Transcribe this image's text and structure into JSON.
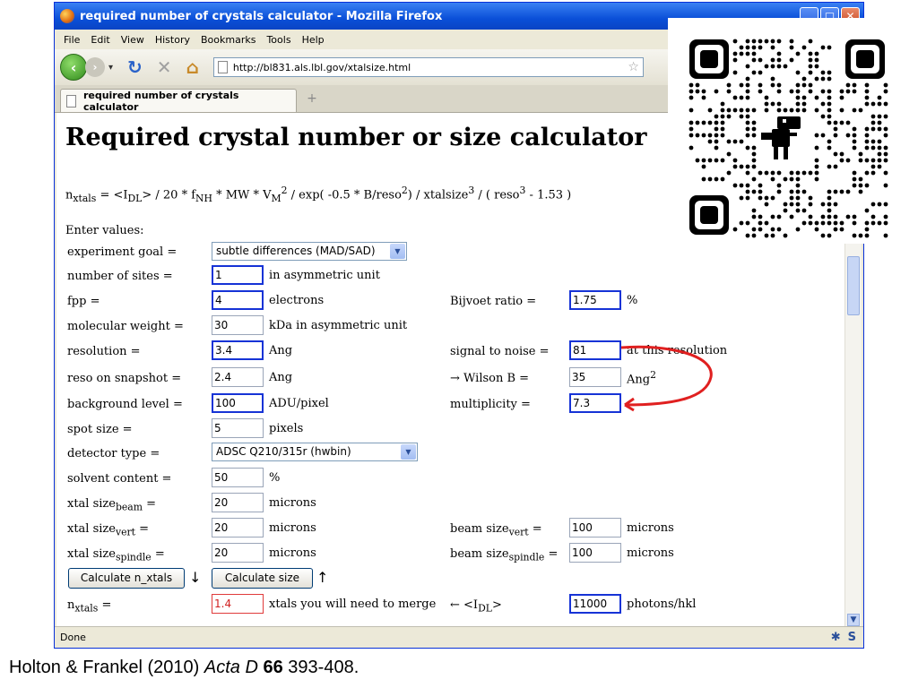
{
  "window": {
    "title": "required number of crystals calculator - Mozilla Firefox"
  },
  "menu": [
    "File",
    "Edit",
    "View",
    "History",
    "Bookmarks",
    "Tools",
    "Help"
  ],
  "nav": {
    "url": "http://bl831.als.lbl.gov/xtalsize.html"
  },
  "tab": {
    "label": "required number of crystals calculator",
    "new_tab_glyph": "+"
  },
  "page": {
    "heading": "Required crystal number or size calculator",
    "formula": "n_xtals = <I_DL> / 20 * f_NH * MW * V_M^2 / exp( -0.5 * B/reso^2) / xtalsize^3 / ( reso^3 - 1.53 )",
    "formula_parts": {
      "n": "n",
      "n_sub": "xtals",
      "eq1": " = <I",
      "idl_sub": "DL",
      "eq2": "> / 20 * f",
      "fnh_sub": "NH",
      "eq3": " * MW * V",
      "vm_sub": "M",
      "vm_sup": "2",
      "eq4": " / exp( -0.5 * B/reso",
      "reso_sup": "2",
      "eq5": ") / xtalsize",
      "xtal_sup": "3",
      "eq6": " / ( reso",
      "reso3_sup": "3",
      "eq7": " - 1.53 )"
    },
    "enter_values": "Enter values:",
    "rows": {
      "goal_label": "experiment goal =",
      "goal_value": "subtle differences (MAD/SAD)",
      "sites_label": "number of sites =",
      "sites_value": "1",
      "sites_unit": "in asymmetric unit",
      "fpp_label": "fpp =",
      "fpp_value": "4",
      "fpp_unit": "electrons",
      "mw_label": "molecular weight =",
      "mw_value": "30",
      "mw_unit": "kDa in asymmetric unit",
      "res_label": "resolution =",
      "res_value": "3.4",
      "res_unit": "Ang",
      "snap_label": "reso on snapshot =",
      "snap_value": "2.4",
      "snap_unit": "Ang",
      "bg_label": "background level =",
      "bg_value": "100",
      "bg_unit": "ADU/pixel",
      "spot_label": "spot size =",
      "spot_value": "5",
      "spot_unit": "pixels",
      "det_label": "detector type =",
      "det_value": "ADSC Q210/315r (hwbin)",
      "solv_label": "solvent content =",
      "solv_value": "50",
      "solv_unit": "%",
      "xbeam_label": "xtal size",
      "xbeam_sub": "beam",
      "xbeam_eq": " =",
      "xbeam_value": "20",
      "xbeam_unit": "microns",
      "xvert_label": "xtal size",
      "xvert_sub": "vert",
      "xvert_eq": " =",
      "xvert_value": "20",
      "xvert_unit": "microns",
      "xspin_label": "xtal size",
      "xspin_sub": "spindle",
      "xspin_eq": " =",
      "xspin_value": "20",
      "xspin_unit": "microns",
      "nx_label": "n",
      "nx_sub": "xtals",
      "nx_eq": " =",
      "nx_value": "1.4",
      "nx_unit": "xtals you will need to merge"
    },
    "right": {
      "bijvoet_label": "Bijvoet ratio =",
      "bijvoet_value": "1.75",
      "bijvoet_unit": "%",
      "sn_label": "signal to noise =",
      "sn_value": "81",
      "sn_unit": "at this resolution",
      "wilson_label": "→ Wilson B =",
      "wilson_value": "35",
      "wilson_unit": "Ang",
      "wilson_sup": "2",
      "mult_label": "multiplicity =",
      "mult_value": "7.3",
      "bvert_label": "beam size",
      "bvert_sub": "vert",
      "bvert_eq": " =",
      "bvert_value": "100",
      "bvert_unit": "microns",
      "bspin_label": "beam size",
      "bspin_sub": "spindle",
      "bspin_eq": " =",
      "bspin_value": "100",
      "bspin_unit": "microns",
      "idl_label_pre": "← <I",
      "idl_sub": "DL",
      "idl_label_post": ">",
      "idl_value": "11000",
      "idl_unit": "photons/hkl"
    },
    "buttons": {
      "calc_n": "Calculate n_xtals",
      "calc_n_arrow": "↓",
      "calc_size": "Calculate size",
      "calc_size_arrow": "↑"
    }
  },
  "status": {
    "text": "Done"
  },
  "caption": {
    "authors": "Holton & Frankel (2010) ",
    "journal": "Acta D",
    "volume": "66",
    "pages": " 393-408."
  },
  "colors": {
    "title_bar": "#0a4fd8",
    "annotation_red": "#e02020",
    "highlight_border": "#1633d6"
  }
}
